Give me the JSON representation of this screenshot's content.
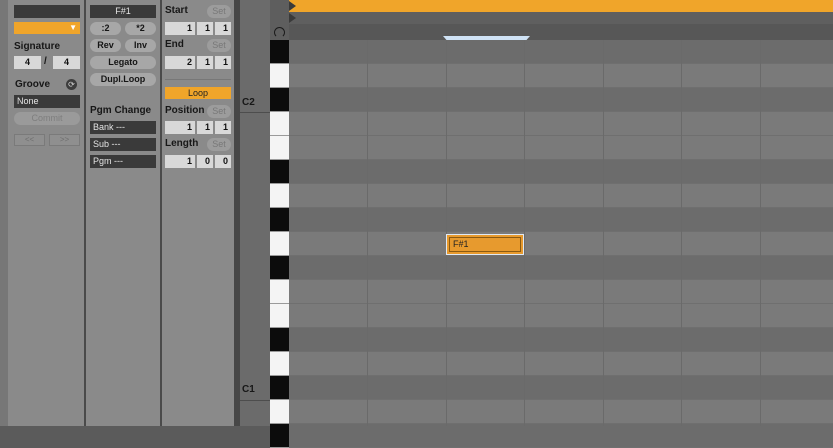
{
  "clip": {
    "signature_label": "Signature",
    "signature_num": "4",
    "signature_slash": "/",
    "signature_den": "4",
    "groove_label": "Groove",
    "groove_value": "None",
    "commit_label": "Commit",
    "prev_label": "<<",
    "next_label": ">>"
  },
  "notes": {
    "note_name": "F#1",
    "half_label": ":2",
    "double_label": "*2",
    "rev_label": "Rev",
    "inv_label": "Inv",
    "legato_label": "Legato",
    "dupl_loop_label": "Dupl.Loop",
    "pgm_change_label": "Pgm Change",
    "bank_label": "Bank ---",
    "sub_label": "Sub ---",
    "pgm_label": "Pgm ---"
  },
  "loop": {
    "start_label": "Start",
    "start": [
      "1",
      "1",
      "1"
    ],
    "end_label": "End",
    "end": [
      "2",
      "1",
      "1"
    ],
    "loop_label": "Loop",
    "position_label": "Position",
    "position": [
      "1",
      "1",
      "1"
    ],
    "length_label": "Length",
    "length": [
      "1",
      "0",
      "0"
    ],
    "set_label": "Set"
  },
  "piano": {
    "c2_label": "C2",
    "c1_label": "C1"
  },
  "note_clip": {
    "label": "F#1"
  },
  "colors": {
    "accent": "#f0a52a",
    "note_fill": "#e79a2e",
    "grid_light": "#7a7a7a",
    "grid_dark": "#6c6c6c"
  }
}
